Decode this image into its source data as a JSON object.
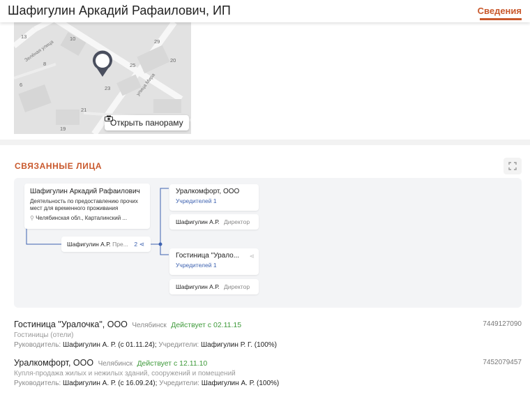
{
  "header": {
    "title": "Шафигулин Аркадий Рафаилович, ИП",
    "tab_label": "Сведения"
  },
  "map": {
    "house_numbers": [
      "13",
      "10",
      "8",
      "6",
      "29",
      "25",
      "20",
      "23",
      "21",
      "19",
      "19"
    ],
    "street_labels": [
      "Зелёная улица",
      "улица Мира"
    ],
    "panorama_button": "Открыть панораму"
  },
  "related": {
    "section_title": "СВЯЗАННЫЕ ЛИЦА",
    "graph": {
      "main": {
        "name": "Шафигулин Аркадий Рафаилович",
        "activity": "Деятельность по предоставлению прочих мест для временного проживания",
        "address": "Челябинская обл., Карталинский ..."
      },
      "connector": {
        "person": "Шафигулин А.Р.",
        "role": "Пре...",
        "count": "2"
      },
      "companies": [
        {
          "name": "Уралкомфорт, ООО",
          "founders": "Учредителей 1",
          "director_name": "Шафигулин А.Р.",
          "director_role": "Директор"
        },
        {
          "name": "Гостиница \"Урало...",
          "founders": "Учредителей 1",
          "director_name": "Шафигулин А.Р.",
          "director_role": "Директор"
        }
      ]
    },
    "list": [
      {
        "name": "Гостиница \"Уралочка\", ООО",
        "city": "Челябинск",
        "status": "Действует с 02.11.15",
        "inn": "7449127090",
        "activity": "Гостиницы (отели)",
        "head_label": "Руководитель:",
        "head_value": "Шафигулин А. Р. (с 01.11.24);",
        "founders_label": "Учредители:",
        "founders_value": "Шафигулин Р. Г. (100%)"
      },
      {
        "name": "Уралкомфорт, ООО",
        "city": "Челябинск",
        "status": "Действует с 12.11.10",
        "inn": "7452079457",
        "activity": "Купля-продажа жилых и нежилых зданий, сооружений и помещений",
        "head_label": "Руководитель:",
        "head_value": "Шафигулин А. Р. (с 16.09.24);",
        "founders_label": "Учредители:",
        "founders_value": "Шафигулин А. Р. (100%)"
      }
    ]
  },
  "colors": {
    "accent": "#c9592d",
    "link_blue": "#3d62b0",
    "status_green": "#3e9a3a",
    "graph_bg": "#f3f4f6",
    "map_bg": "#e3e3e3"
  }
}
